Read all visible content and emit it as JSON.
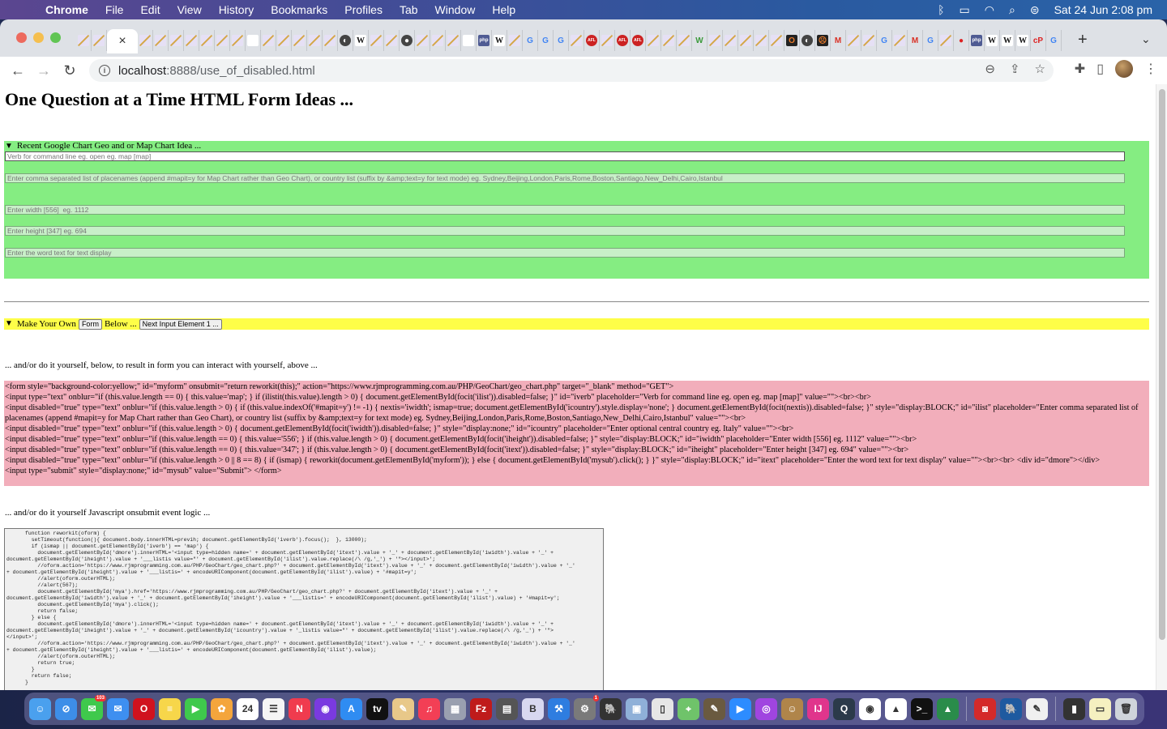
{
  "menubar": {
    "app": "Chrome",
    "items": [
      "File",
      "Edit",
      "View",
      "History",
      "Bookmarks",
      "Profiles",
      "Tab",
      "Window",
      "Help"
    ],
    "clock": "Sat 24 Jun  2:08 pm",
    "status_icons": [
      "bluetooth-icon",
      "battery-charging-icon",
      "wifi-icon",
      "spotlight-search-icon",
      "control-center-icon"
    ]
  },
  "browser": {
    "tabs": [
      {
        "icon": "pen"
      },
      {
        "icon": "pen"
      },
      {
        "icon": "close",
        "active": true
      },
      {
        "icon": "pen"
      },
      {
        "icon": "pen"
      },
      {
        "icon": "pen"
      },
      {
        "icon": "pen"
      },
      {
        "icon": "pen"
      },
      {
        "icon": "pen"
      },
      {
        "icon": "pen"
      },
      {
        "icon": "blank"
      },
      {
        "icon": "pen"
      },
      {
        "icon": "pen"
      },
      {
        "icon": "pen"
      },
      {
        "icon": "pen"
      },
      {
        "icon": "pen"
      },
      {
        "icon": "globe-blue"
      },
      {
        "icon": "wikipedia"
      },
      {
        "icon": "pen"
      },
      {
        "icon": "pen"
      },
      {
        "icon": "globe"
      },
      {
        "icon": "pen"
      },
      {
        "icon": "pen"
      },
      {
        "icon": "pen"
      },
      {
        "icon": "blank"
      },
      {
        "icon": "php"
      },
      {
        "icon": "wikipedia"
      },
      {
        "icon": "pen"
      },
      {
        "icon": "google"
      },
      {
        "icon": "google"
      },
      {
        "icon": "google"
      },
      {
        "icon": "pen"
      },
      {
        "icon": "afl"
      },
      {
        "icon": "pen"
      },
      {
        "icon": "afl"
      },
      {
        "icon": "afl"
      },
      {
        "icon": "pen"
      },
      {
        "icon": "pen"
      },
      {
        "icon": "pen"
      },
      {
        "icon": "w-green"
      },
      {
        "icon": "pen"
      },
      {
        "icon": "pen"
      },
      {
        "icon": "pen"
      },
      {
        "icon": "pen"
      },
      {
        "icon": "pen"
      },
      {
        "icon": "opera-dark"
      },
      {
        "icon": "globe-blue"
      },
      {
        "icon": "folder-face"
      },
      {
        "icon": "gmail"
      },
      {
        "icon": "pen"
      },
      {
        "icon": "pen"
      },
      {
        "icon": "google"
      },
      {
        "icon": "pen"
      },
      {
        "icon": "gmail"
      },
      {
        "icon": "google"
      },
      {
        "icon": "pen"
      },
      {
        "icon": "redhat"
      },
      {
        "icon": "php"
      },
      {
        "icon": "wikipedia"
      },
      {
        "icon": "wikipedia"
      },
      {
        "icon": "wikipedia"
      },
      {
        "icon": "cpanel"
      },
      {
        "icon": "google"
      }
    ],
    "url_host": "localhost",
    "url_path": ":8888/use_of_disabled.html"
  },
  "page": {
    "title": "One Question at a Time HTML Form Ideas ...",
    "green_section": {
      "summary": "Recent Google Chart Geo and or Map Chart Idea ...",
      "inputs": [
        {
          "placeholder": "Verb for command line eg. open eg. map [map]",
          "value": "",
          "disabled": false
        },
        {
          "placeholder": "Enter comma separated list of placenames (append #mapit=y for Map Chart rather than Geo Chart), or country list (suffix by &amp;text=y for text mode) eg. Sydney,Beijing,London,Paris,Rome,Boston,Santiago,New_Delhi,Cairo,Istanbul",
          "value": "",
          "disabled": true
        },
        {
          "placeholder": "Enter width [556]  eg. 1112",
          "value": "",
          "disabled": true
        },
        {
          "placeholder": "Enter height [347] eg. 694",
          "value": "",
          "disabled": true
        },
        {
          "placeholder": "Enter the word text for text display",
          "value": "",
          "disabled": true
        }
      ]
    },
    "yellow_section": {
      "summary_prefix": "Make Your Own",
      "form_button": "Form",
      "summary_middle": "Below ...",
      "next_button": "Next Input Element 1 ..."
    },
    "note1": "... and/or do it yourself, below, to result in form you can interact with yourself, above ...",
    "html_source_lines": [
      "<form style=\"background-color:yellow;\" id=\"myform\" onsubmit=\"return reworkit(this);\" action=\"https://www.rjmprogramming.com.au/PHP/GeoChart/geo_chart.php\" target=\"_blank\" method=\"GET\">",
      "<input type=\"text\" onblur=\"if (this.value.length == 0) { this.value='map'; } if (ilistit(this.value).length > 0) { document.getElementById(focit('ilist')).disabled=false; }\" id=\"iverb\" placeholder=\"Verb for command line eg. open eg. map [map]\" value=\"\"><br><br>",
      "<input disabled=\"true\" type=\"text\" onblur=\"if (this.value.length > 0) { if (this.value.indexOf('#mapit=y') != -1) { nextis='iwidth'; ismap=true; document.getElementById('icountry').style.display='none'; } document.getElementById(focit(nextis)).disabled=false; }\" style=\"display:BLOCK;\" id=\"ilist\" placeholder=\"Enter comma separated list of placenames (append #mapit=y for Map Chart rather than Geo Chart), or country list (suffix by &amp;text=y for text mode) eg. Sydney,Beijing,London,Paris,Rome,Boston,Santiago,New_Delhi,Cairo,Istanbul\" value=\"\"><br>",
      "<input disabled=\"true\" type=\"text\" onblur=\"if (this.value.length > 0) { document.getElementById(focit('iwidth')).disabled=false; }\" style=\"display:none;\" id=\"icountry\" placeholder=\"Enter optional central country eg. Italy\" value=\"\"><br>",
      "<input disabled=\"true\" type=\"text\" onblur=\"if (this.value.length == 0) { this.value='556'; } if (this.value.length > 0) { document.getElementById(focit('iheight')).disabled=false; }\" style=\"display:BLOCK;\" id=\"iwidth\" placeholder=\"Enter width [556] eg. 1112\" value=\"\"><br>",
      "<input disabled=\"true\" type=\"text\" onblur=\"if (this.value.length == 0) { this.value='347'; } if (this.value.length > 0) { document.getElementById(focit('itext')).disabled=false; }\" style=\"display:BLOCK;\" id=\"iheight\" placeholder=\"Enter height [347] eg. 694\" value=\"\"><br>",
      "<input disabled=\"true\" type=\"text\" onblur=\"if (this.value.length > 0 || 8 == 8) { if (ismap) { reworkit(document.getElementById('myform')); } else { document.getElementById('mysub').click(); } }\" style=\"display:BLOCK;\" id=\"itext\" placeholder=\"Enter the word text for text display\" value=\"\"><br><br> <div id=\"dmore\"></div>",
      "<input type=\"submit\" style=\"display:none;\" id=\"mysub\" value=\"Submit\"> </form>"
    ],
    "note2": "... and/or do it yourself Javascript onsubmit event logic ...",
    "js_source": "      function reworkit(oform) {\n        setTimeout(function(){ document.body.innerHTML=previh; document.getElementById('iverb').focus();  }, 13000);\n        if (ismap || document.getElementById('iverb') == 'map') {\n          document.getElementById('dmore').innerHTML='<input type=hidden name=' + document.getElementById('itext').value + '_' + document.getElementById('iwidth').value + '_' +\ndocument.getElementById('iheight').value + '___listis value=\"' + document.getElementById('ilist').value.replace(/\\ /g,'_') + '\"></input>';\n          //oform.action='https://www.rjmprogramming.com.au/PHP/GeoChart/geo_chart.php?' + document.getElementById('itext').value + '_' + document.getElementById('iwidth').value + '_'\n+ document.getElementById('iheight').value + '___listis=' + encodeURIComponent(document.getElementById('ilist').value) + '#mapit=y';\n          //alert(oform.outerHTML);\n          //alert(567);\n          document.getElementById('mya').href='https://www.rjmprogramming.com.au/PHP/GeoChart/geo_chart.php?' + document.getElementById('itext').value + '_' +\ndocument.getElementById('iwidth').value + '_' + document.getElementById('iheight').value + '___listis=' + encodeURIComponent(document.getElementById('ilist').value) + '#mapit=y';\n          document.getElementById('mya').click();\n          return false;\n        } else {\n          document.getElementById('dmore').innerHTML='<input type=hidden name=' + document.getElementById('itext').value + '_' + document.getElementById('iwidth').value + '_' +\ndocument.getElementById('iheight').value + '_' + document.getElementById('icountry').value + '_listis value=\"' + document.getElementById('ilist').value.replace(/\\ /g,'_') + '\">\n</input>';\n          //oform.action='https://www.rjmprogramming.com.au/PHP/GeoChart/geo_chart.php?' + document.getElementById('itext').value + '_' + document.getElementById('iwidth').value + '_'\n+ document.getElementById('iheight').value + '___listis=' + encodeURIComponent(document.getElementById('ilist').value);\n          //alert(oform.outerHTML);\n          return true;\n        }\n        return false;\n      }"
  },
  "dock": {
    "apps": [
      {
        "name": "finder",
        "color": "#4aa0ee",
        "glyph": "☺"
      },
      {
        "name": "safari",
        "color": "#3d8ee8",
        "glyph": "⊘"
      },
      {
        "name": "messages",
        "color": "#3fc94c",
        "glyph": "✉",
        "badge": "103"
      },
      {
        "name": "mail",
        "color": "#3e8ff0",
        "glyph": "✉"
      },
      {
        "name": "opera",
        "color": "#d0121e",
        "glyph": "O"
      },
      {
        "name": "notes",
        "color": "#f7d64a",
        "glyph": "≡"
      },
      {
        "name": "facetime",
        "color": "#3fc94c",
        "glyph": "▶"
      },
      {
        "name": "photos",
        "color": "#f4a53c",
        "glyph": "✿"
      },
      {
        "name": "calendar",
        "color": "#ffffff",
        "glyph": "24"
      },
      {
        "name": "reminders",
        "color": "#f5f5f5",
        "glyph": "☰"
      },
      {
        "name": "news",
        "color": "#f03b4e",
        "glyph": "N"
      },
      {
        "name": "firefox",
        "color": "#7a3ae0",
        "glyph": "◉"
      },
      {
        "name": "app-store",
        "color": "#2f8cf2",
        "glyph": "A"
      },
      {
        "name": "apple-tv",
        "color": "#111111",
        "glyph": "tv"
      },
      {
        "name": "paintbrush",
        "color": "#e8c889",
        "glyph": "✎"
      },
      {
        "name": "music",
        "color": "#f33f55",
        "glyph": "♫"
      },
      {
        "name": "launchpad",
        "color": "#9aa0b0",
        "glyph": "▦"
      },
      {
        "name": "filezilla",
        "color": "#bf1b1b",
        "glyph": "Fz"
      },
      {
        "name": "calculator",
        "color": "#555555",
        "glyph": "▤"
      },
      {
        "name": "bbedit",
        "color": "#d8d8f0",
        "glyph": "B"
      },
      {
        "name": "xcode",
        "color": "#2e7de0",
        "glyph": "⚒"
      },
      {
        "name": "system-preferences",
        "color": "#7a7a7a",
        "glyph": "⚙",
        "badge": "1"
      },
      {
        "name": "mamp",
        "color": "#333333",
        "glyph": "🐘"
      },
      {
        "name": "preview",
        "color": "#8fb0d8",
        "glyph": "▣"
      },
      {
        "name": "textedit-doc",
        "color": "#e6e6e6",
        "glyph": "▯"
      },
      {
        "name": "maps",
        "color": "#6fc36a",
        "glyph": "⌖"
      },
      {
        "name": "gimp",
        "color": "#6a5a40",
        "glyph": "✎"
      },
      {
        "name": "zoom",
        "color": "#2d8cff",
        "glyph": "▶"
      },
      {
        "name": "podcasts",
        "color": "#a045e0",
        "glyph": "◎"
      },
      {
        "name": "contacts",
        "color": "#b0854a",
        "glyph": "☺"
      },
      {
        "name": "intellij",
        "color": "#e0358c",
        "glyph": "IJ"
      },
      {
        "name": "quicktime",
        "color": "#2b3a4a",
        "glyph": "Q"
      },
      {
        "name": "chrome",
        "color": "#ffffff",
        "glyph": "◉"
      },
      {
        "name": "inkscape",
        "color": "#ffffff",
        "glyph": "▲"
      },
      {
        "name": "terminal",
        "color": "#111111",
        "glyph": ">_"
      },
      {
        "name": "cad",
        "color": "#2a8c4a",
        "glyph": "▲"
      }
    ],
    "apps_right": [
      {
        "name": "photo-booth",
        "color": "#d42a2a",
        "glyph": "◙"
      },
      {
        "name": "mamp-pro",
        "color": "#1e5aa0",
        "glyph": "🐘"
      },
      {
        "name": "textedit",
        "color": "#f0f0f0",
        "glyph": "✎"
      }
    ],
    "apps_docs": [
      {
        "name": "downloads-stack",
        "color": "#333333",
        "glyph": "▮"
      },
      {
        "name": "screenshot-stack",
        "color": "#f5f0c0",
        "glyph": "▭"
      },
      {
        "name": "trash",
        "color": "#cfd4da",
        "glyph": "🗑"
      }
    ]
  }
}
